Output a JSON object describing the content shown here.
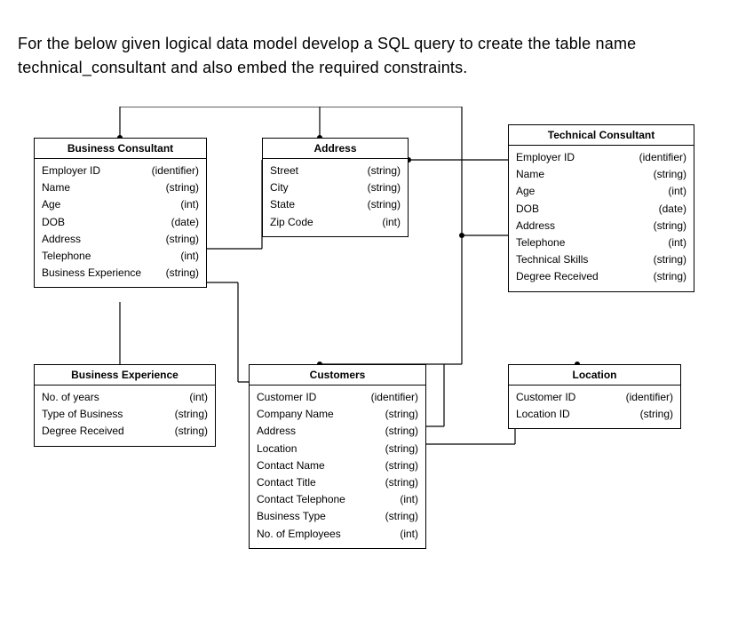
{
  "prompt_text": "For the below given logical data model develop a SQL query to create the table name technical_consultant and also embed the required constraints.",
  "entities": {
    "business_consultant": {
      "title": "Business Consultant",
      "attrs": [
        {
          "name": "Employer ID",
          "type": "(identifier)"
        },
        {
          "name": "Name",
          "type": "(string)"
        },
        {
          "name": "Age",
          "type": "(int)"
        },
        {
          "name": "DOB",
          "type": "(date)"
        },
        {
          "name": "Address",
          "type": "(string)"
        },
        {
          "name": "Telephone",
          "type": "(int)"
        },
        {
          "name": "Business Experience",
          "type": "(string)"
        }
      ]
    },
    "address": {
      "title": "Address",
      "attrs": [
        {
          "name": "Street",
          "type": "(string)"
        },
        {
          "name": "City",
          "type": "(string)"
        },
        {
          "name": "State",
          "type": "(string)"
        },
        {
          "name": "Zip Code",
          "type": "(int)"
        }
      ]
    },
    "technical_consultant": {
      "title": "Technical Consultant",
      "attrs": [
        {
          "name": "Employer ID",
          "type": "(identifier)"
        },
        {
          "name": "Name",
          "type": "(string)"
        },
        {
          "name": "Age",
          "type": "(int)"
        },
        {
          "name": "DOB",
          "type": "(date)"
        },
        {
          "name": "Address",
          "type": "(string)"
        },
        {
          "name": "Telephone",
          "type": "(int)"
        },
        {
          "name": "Technical Skills",
          "type": "(string)"
        },
        {
          "name": "Degree Received",
          "type": "(string)"
        }
      ]
    },
    "business_experience": {
      "title": "Business Experience",
      "attrs": [
        {
          "name": "No. of years",
          "type": "(int)"
        },
        {
          "name": "Type of Business",
          "type": "(string)"
        },
        {
          "name": "Degree Received",
          "type": "(string)"
        }
      ]
    },
    "customers": {
      "title": "Customers",
      "attrs": [
        {
          "name": "Customer ID",
          "type": "(identifier)"
        },
        {
          "name": "Company Name",
          "type": "(string)"
        },
        {
          "name": "Address",
          "type": "(string)"
        },
        {
          "name": "Location",
          "type": "(string)"
        },
        {
          "name": "Contact Name",
          "type": "(string)"
        },
        {
          "name": "Contact Title",
          "type": "(string)"
        },
        {
          "name": "Contact Telephone",
          "type": "(int)"
        },
        {
          "name": "Business Type",
          "type": "(string)"
        },
        {
          "name": "No. of Employees",
          "type": "(int)"
        }
      ]
    },
    "location": {
      "title": "Location",
      "attrs": [
        {
          "name": "Customer ID",
          "type": "(identifier)"
        },
        {
          "name": "Location ID",
          "type": "(string)"
        }
      ]
    }
  }
}
